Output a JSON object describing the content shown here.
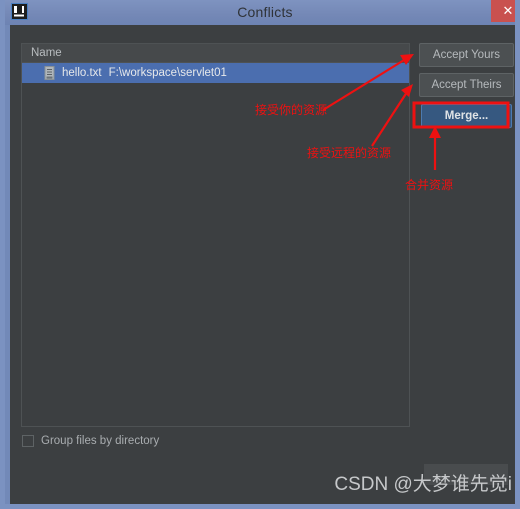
{
  "window": {
    "title": "Conflicts",
    "app_icon": "idea-app-icon",
    "close_label": "✕",
    "accent_blue": "#4b6eaf",
    "title_bar_color": "#7488b6",
    "close_button_color": "#c9514f",
    "body_color": "#3c3f41",
    "annotation_color": "#ee1111"
  },
  "list": {
    "header": {
      "name": "Name"
    },
    "rows": [
      {
        "file": "hello.txt",
        "path": "F:\\workspace\\servlet01",
        "selected": true
      }
    ]
  },
  "buttons": {
    "accept_yours": "Accept Yours",
    "accept_theirs": "Accept Theirs",
    "merge": "Merge..."
  },
  "options": {
    "group_files_label": "Group files by directory",
    "group_files_checked": false
  },
  "annotations": [
    {
      "text": "接受你的资源",
      "target": "accept-yours"
    },
    {
      "text": "接受远程的资源",
      "target": "accept-theirs"
    },
    {
      "text": "合并资源",
      "target": "merge"
    }
  ],
  "watermark": {
    "text": "CSDN @大梦谁先觉i"
  }
}
